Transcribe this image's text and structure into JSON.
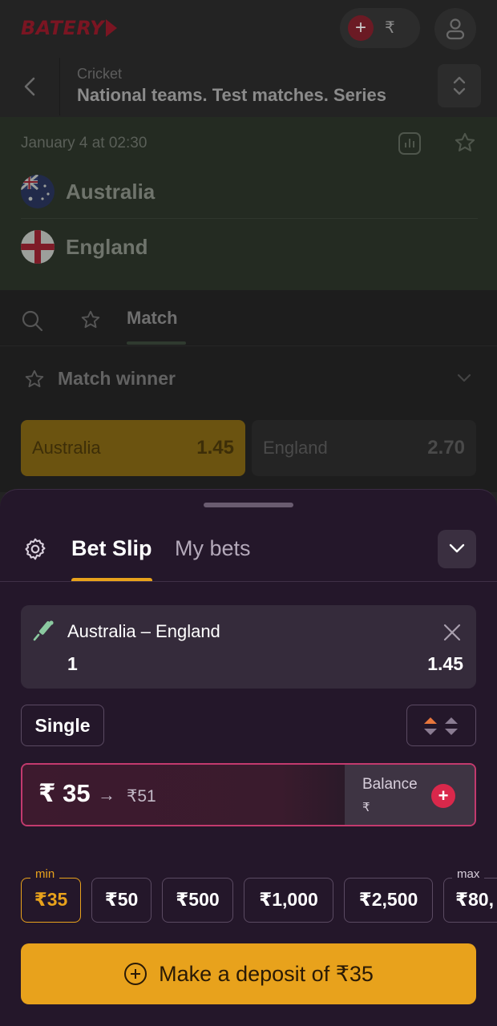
{
  "header": {
    "logo_text": "BATERY",
    "wallet_currency": "₹"
  },
  "breadcrumb": {
    "sport": "Cricket",
    "title": "National teams. Test matches. Series"
  },
  "match": {
    "date": "January 4 at 02:30",
    "team1": "Australia",
    "team2": "England"
  },
  "market_tabs": {
    "match_label": "Match"
  },
  "market": {
    "title": "Match winner",
    "outcomes": [
      {
        "name": "Australia",
        "odds": "1.45"
      },
      {
        "name": "England",
        "odds": "2.70"
      }
    ]
  },
  "betslip": {
    "tab_betslip": "Bet Slip",
    "tab_mybets": "My bets",
    "selection": {
      "event": "Australia – England",
      "outcome": "1",
      "odds": "1.45"
    },
    "bet_type": "Single",
    "stake": "₹ 35",
    "stake_arrow": "→",
    "potential_win": "₹51",
    "balance_label": "Balance",
    "balance_value": "₹",
    "chips": [
      "₹35",
      "₹50",
      "₹500",
      "₹1,000",
      "₹2,500",
      "₹80,"
    ],
    "min_label": "min",
    "max_label": "max",
    "deposit_label": "Make a deposit of ₹35"
  },
  "colors": {
    "accent": "#e8a21c",
    "sheet_bg": "#24172a",
    "stake_border": "#c33a6e",
    "plus_red": "#d9284b"
  }
}
